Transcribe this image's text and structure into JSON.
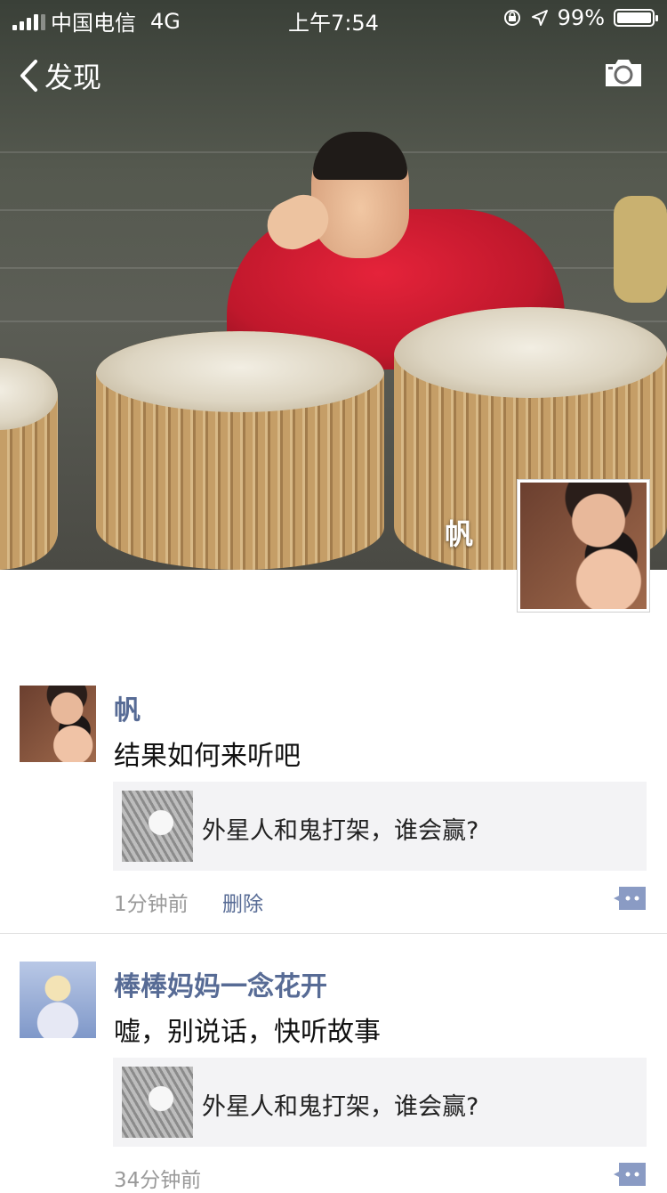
{
  "status_bar": {
    "carrier": "中国电信",
    "network": "4G",
    "time": "上午7:54",
    "battery": "99%",
    "battery_level": 0.99,
    "signal_bars": 4
  },
  "nav": {
    "back_label": "发现",
    "back_icon": "chevron-left-icon",
    "camera_icon": "camera-icon"
  },
  "cover": {
    "name": "帆"
  },
  "posts": [
    {
      "name": "帆",
      "text": "结果如何来听吧",
      "share_title": "外星人和鬼打架，谁会赢?",
      "time": "1分钟前",
      "delete_label": "删除"
    },
    {
      "name": "棒棒妈妈一念花开",
      "text": "嘘，别说话，快听故事",
      "share_title": "外星人和鬼打架，谁会赢?",
      "time": "34分钟前"
    }
  ],
  "colors": {
    "link": "#576b95",
    "meta": "#9a9a9a",
    "card": "#f3f3f5"
  }
}
